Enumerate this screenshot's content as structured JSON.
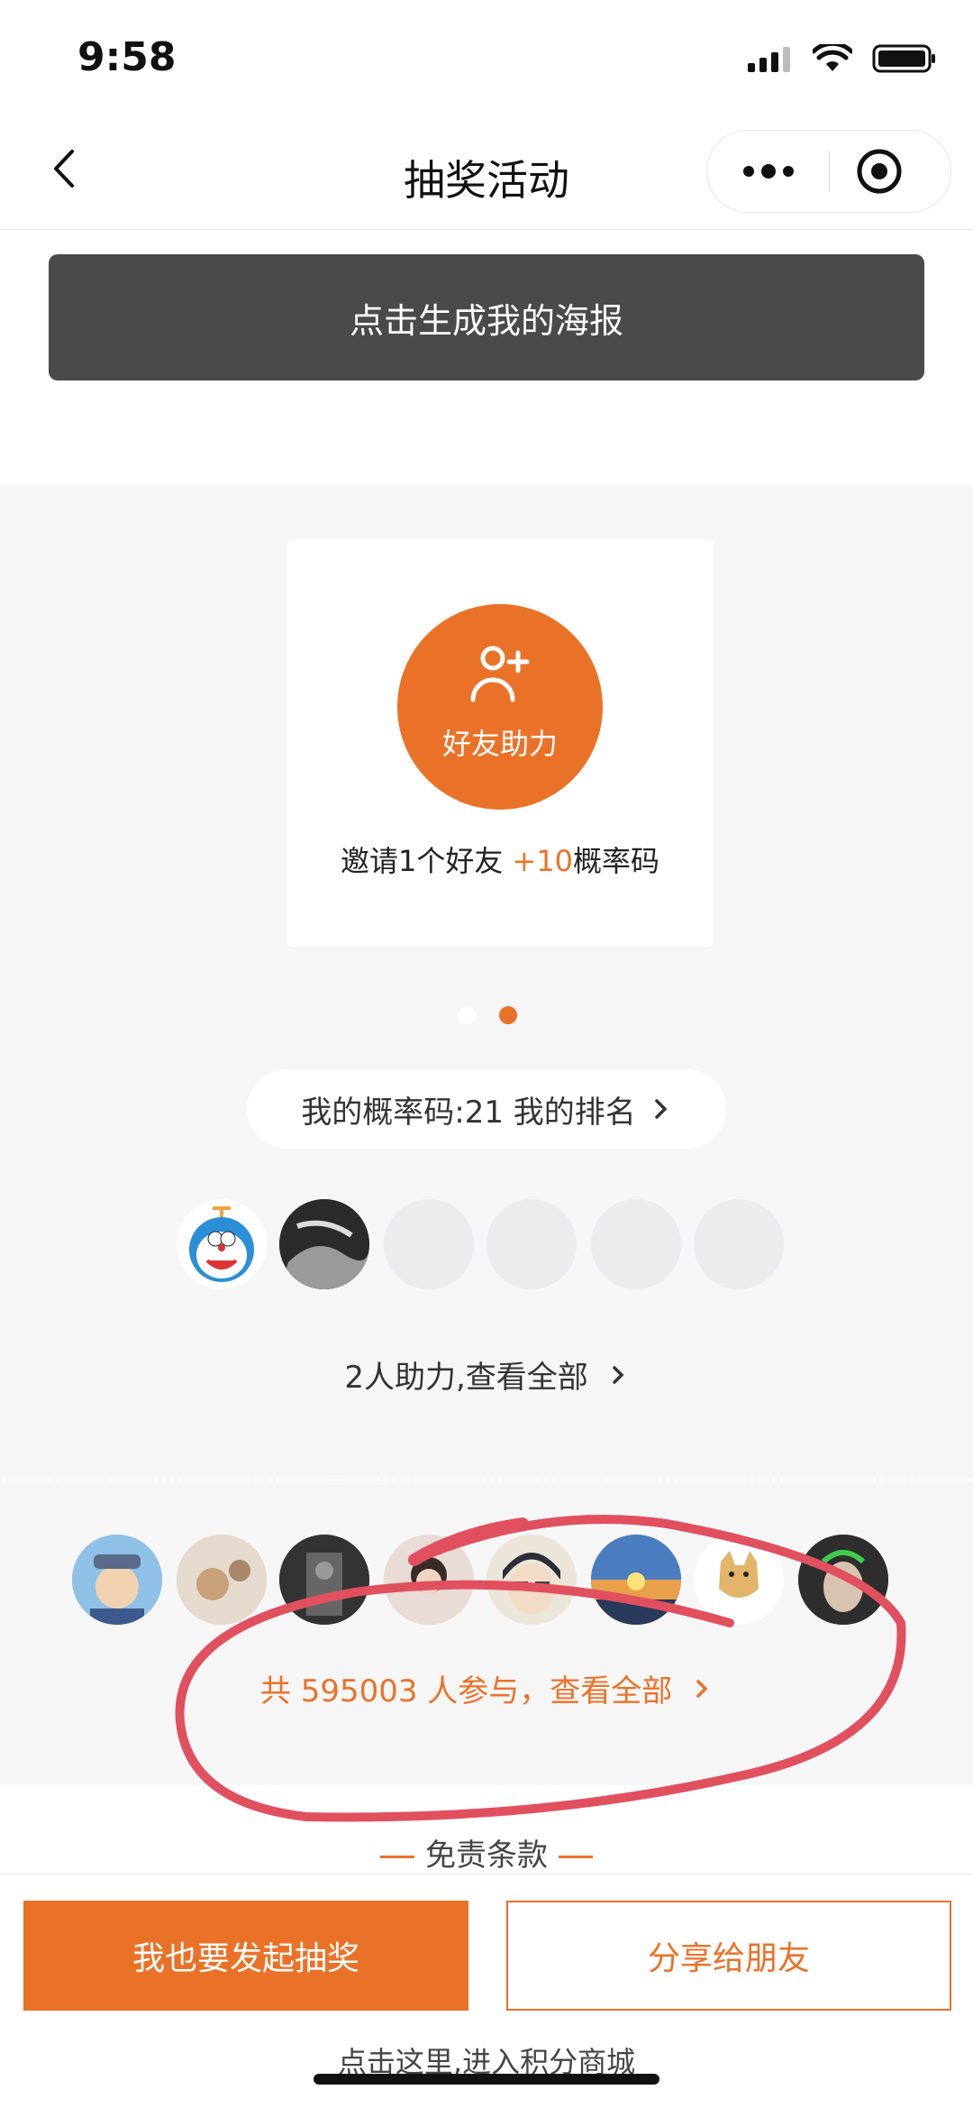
{
  "status_bar": {
    "time": "9:58"
  },
  "nav": {
    "title": "抽奖活动"
  },
  "poster_button": {
    "label": "点击生成我的海报"
  },
  "help_card": {
    "circle_label": "好友助力",
    "invite_prefix": "邀请1个好友 ",
    "invite_bonus": "+10",
    "invite_suffix": "概率码"
  },
  "carousel": {
    "active_index": 1,
    "count": 2
  },
  "rank_pill": {
    "label": "我的概率码:21 我的排名"
  },
  "helpers": {
    "count_filled": 2,
    "slots": 6,
    "link_text": "2人助力,查看全部"
  },
  "participants": {
    "link_text": "共 595003 人参与，查看全部"
  },
  "disclaimer": {
    "label": "免责条款"
  },
  "bottom_buttons": {
    "start_label": "我也要发起抽奖",
    "share_label": "分享给朋友"
  },
  "mall_link": {
    "label": "点击这里,进入积分商城"
  },
  "colors": {
    "accent": "#ea7228",
    "dark_button": "#4a4a4a",
    "annotation": "#e0505e"
  },
  "icons": [
    "back-icon",
    "more-icon",
    "record-icon",
    "add-friend-icon",
    "chevron-right-icon"
  ]
}
